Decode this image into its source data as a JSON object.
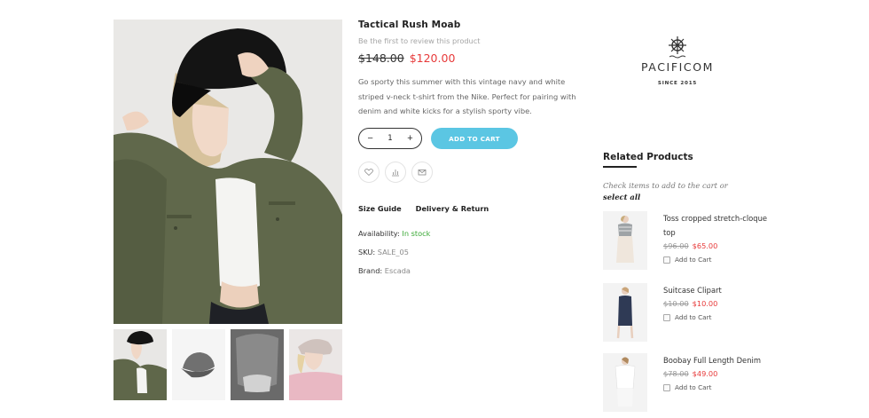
{
  "product": {
    "title": "Tactical Rush Moab",
    "review_link": "Be the first to review this product",
    "old_price": "$148.00",
    "new_price": "$120.00",
    "description": "Go sporty this summer with this vintage navy and white striped v-neck t-shirt from the Nike. Perfect for pairing with denim and white kicks for a stylish sporty vibe.",
    "quantity": "1",
    "qty_minus": "−",
    "qty_plus": "+",
    "add_to_cart": "ADD TO CART",
    "size_guide": "Size Guide",
    "delivery_return": "Delivery & Return",
    "availability_label": "Availability:",
    "availability_value": "In stock",
    "sku_label": "SKU:",
    "sku_value": "SALE_05",
    "brand_label": "Brand:",
    "brand_value": "Escada",
    "action_icons": [
      "heart-icon",
      "compare-icon",
      "email-icon"
    ]
  },
  "brand_logo": {
    "name": "PACIFICOM",
    "since": "SINCE 2015",
    "icon": "ship-wheel-icon"
  },
  "related": {
    "title": "Related Products",
    "hint_prefix": "Check items to add to the cart or",
    "hint_link": "select all",
    "items": [
      {
        "name": "Toss cropped stretch-cloque top",
        "old_price": "$96.00",
        "new_price": "$65.00",
        "add_label": "Add to Cart"
      },
      {
        "name": "Suitcase Clipart",
        "old_price": "$10.00",
        "new_price": "$10.00",
        "add_label": "Add to Cart"
      },
      {
        "name": "Boobay Full Length Denim",
        "old_price": "$78.00",
        "new_price": "$49.00",
        "add_label": "Add to Cart"
      }
    ]
  },
  "colors": {
    "accent": "#5bc6e3",
    "sale_price": "#e73a3a",
    "in_stock": "#3aa935"
  }
}
